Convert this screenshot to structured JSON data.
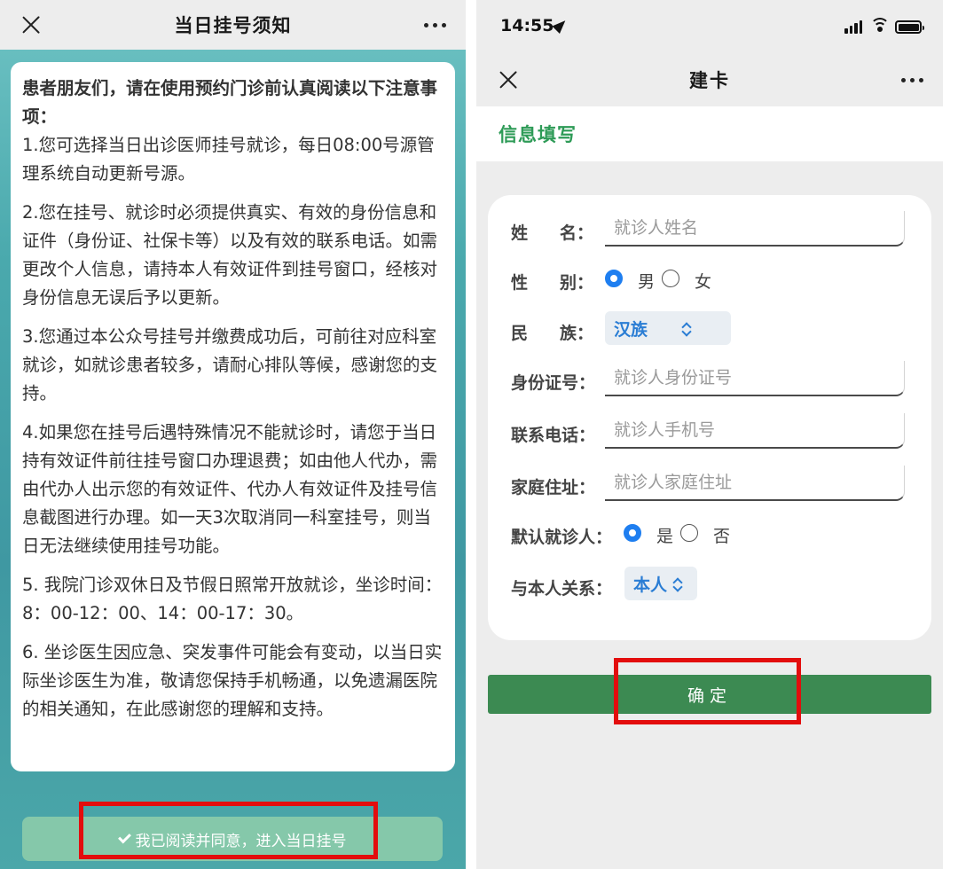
{
  "left": {
    "nav": {
      "title": "当日挂号须知"
    },
    "notice": {
      "heading": "患者朋友们，请在使用预约门诊前认真阅读以下注意事项：",
      "paragraphs": [
        "1.您可选择当日出诊医师挂号就诊，每日08:00号源管理系统自动更新号源。",
        "2.您在挂号、就诊时必须提供真实、有效的身份信息和证件（身份证、社保卡等）以及有效的联系电话。如需更改个人信息，请持本人有效证件到挂号窗口，经核对身份信息无误后予以更新。",
        "3.您通过本公众号挂号并缴费成功后，可前往对应科室就诊，如就诊患者较多，请耐心排队等候，感谢您的支持。",
        "4.如果您在挂号后遇特殊情况不能就诊时，请您于当日持有效证件前往挂号窗口办理退费；如由他人代办，需由代办人出示您的有效证件、代办人有效证件及挂号信息截图进行办理。如一天3次取消同一科室挂号，则当日无法继续使用挂号功能。",
        "5. 我院门诊双休日及节假日照常开放就诊，坐诊时间： 8：00-12：00、14：00-17：30。",
        "6. 坐诊医生因应急、突发事件可能会有变动，以当日实际坐诊医生为准，敬请您保持手机畅通，以免遗漏医院的相关通知，在此感谢您的理解和支持。"
      ]
    },
    "agree_button": "我已阅读并同意，进入当日挂号"
  },
  "right": {
    "status": {
      "time": "14:55"
    },
    "nav": {
      "title": "建卡"
    },
    "section_title": "信息填写",
    "form": {
      "name": {
        "label_a": "姓",
        "label_b": "名：",
        "placeholder": "就诊人姓名"
      },
      "gender": {
        "label_a": "性",
        "label_b": "别：",
        "options": [
          "男",
          "女"
        ],
        "selected": "男"
      },
      "ethnicity": {
        "label_a": "民",
        "label_b": "族：",
        "value": "汉族"
      },
      "id_number": {
        "label": "身份证号：",
        "placeholder": "就诊人身份证号"
      },
      "phone": {
        "label": "联系电话：",
        "placeholder": "就诊人手机号"
      },
      "address": {
        "label": "家庭住址：",
        "placeholder": "就诊人家庭住址"
      },
      "default_patient": {
        "label": "默认就诊人：",
        "options": [
          "是",
          "否"
        ],
        "selected": "是"
      },
      "relation": {
        "label": "与本人关系：",
        "value": "本人"
      }
    },
    "confirm_button": "确定"
  },
  "colors": {
    "brand_green": "#2e9b57",
    "confirm_green": "#3c8a52",
    "agree_green": "#85c8aa",
    "radio_blue": "#1e7ef0",
    "select_text_blue": "#2a7dd4",
    "highlight_red": "#e30d0d",
    "teal_background": "#4aa9ad"
  },
  "icons": [
    "close-icon",
    "more-icon",
    "check-icon",
    "location-arrow-icon",
    "signal-icon",
    "wifi-icon",
    "battery-icon",
    "chevron-updown-icon"
  ]
}
